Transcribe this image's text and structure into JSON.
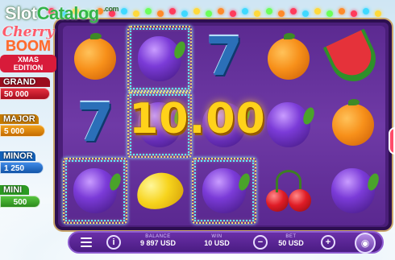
{
  "watermark": {
    "part1": "Slot",
    "part2": "Catalog",
    "part3": ".com"
  },
  "logo": {
    "line1": "Cherry",
    "line2": "BOOM",
    "line3": "XMAS EDITION"
  },
  "jackpots": {
    "grand": {
      "title": "GRAND",
      "value": "50 000"
    },
    "major": {
      "title": "MAJOR",
      "value": "5 000"
    },
    "minor": {
      "title": "MINOR",
      "value": "1 250"
    },
    "mini": {
      "title": "MINI",
      "value": "500"
    }
  },
  "reels": [
    [
      "orange",
      "plum",
      "seven",
      "orange",
      "watermelon"
    ],
    [
      "seven",
      "plum",
      "plum",
      "plum",
      "orange"
    ],
    [
      "plum",
      "lemon",
      "plum",
      "cherry",
      "plum"
    ]
  ],
  "win_cells": [
    [
      0,
      1
    ],
    [
      1,
      1
    ],
    [
      2,
      0
    ],
    [
      2,
      2
    ]
  ],
  "win_amount": "10.00",
  "bottom_bar": {
    "balance_label": "BALANCE",
    "balance_value": "9 897 USD",
    "win_label": "WIN",
    "win_value": "10 USD",
    "bet_label": "BET",
    "bet_value": "50 USD",
    "info_icon": "i",
    "minus_icon": "−",
    "plus_icon": "+"
  },
  "colors": {
    "accent": "#ffd21a",
    "reel_bg": "#6f3aa6",
    "bar_bg": "#4a1c82"
  },
  "icons": [
    "menu-icon",
    "info-icon",
    "minus-icon",
    "plus-icon",
    "coins-icon"
  ]
}
